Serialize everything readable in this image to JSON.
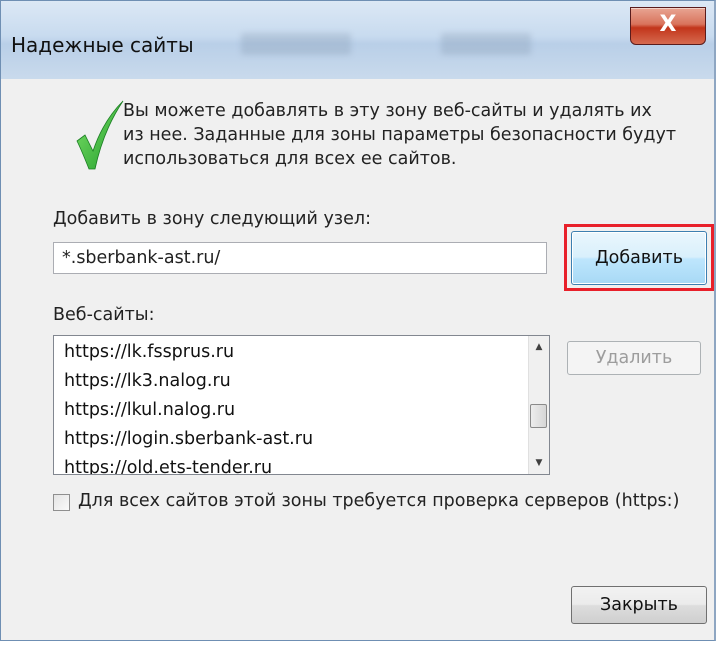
{
  "window": {
    "title": "Надежные сайты",
    "close_symbol": "X"
  },
  "info": {
    "icon": "checkmark-icon",
    "line1": "Вы можете добавлять в эту зону  веб-сайты и удалять их",
    "line2": "из нее. Заданные для зоны параметры безопасности будут",
    "line3": "использоваться для всех ее сайтов."
  },
  "add_site": {
    "label": "Добавить в зону следующий узел:",
    "input_value": "*.sberbank-ast.ru/",
    "add_button": "Добавить",
    "highlight_color": "#e8202a"
  },
  "sites": {
    "label": "Веб-сайты:",
    "items": [
      "https://lk.fssprus.ru",
      "https://lk3.nalog.ru",
      "https://lkul.nalog.ru",
      "https://login.sberbank-ast.ru",
      "https://old.ets-tender.ru"
    ],
    "remove_button": "Удалить"
  },
  "https_check": {
    "label": "Для всех сайтов этой зоны требуется проверка серверов (https:)",
    "checked": false
  },
  "close_button": "Закрыть"
}
